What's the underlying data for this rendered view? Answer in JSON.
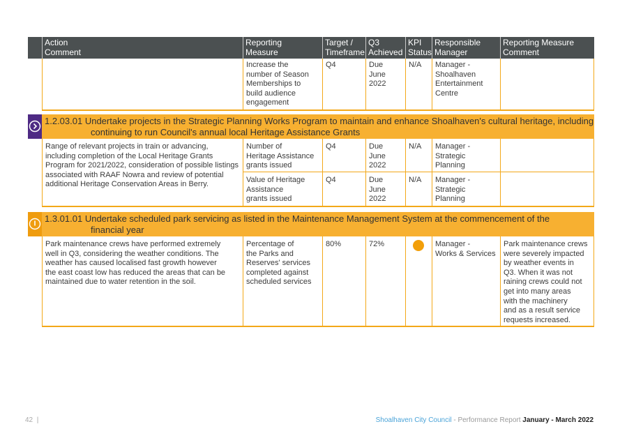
{
  "header": {
    "columns": [
      {
        "label1": "Action",
        "label2": "Comment"
      },
      {
        "label1": "Reporting",
        "label2": "Measure"
      },
      {
        "label1": "Target /",
        "label2": "Timeframe"
      },
      {
        "label1": "Q3",
        "label2": "Achieved"
      },
      {
        "label1": "KPI",
        "label2": "Status"
      },
      {
        "label1": "Responsible",
        "label2": "Manager"
      },
      {
        "label1": "Reporting Measure",
        "label2": "Comment"
      }
    ]
  },
  "continued_row": {
    "action_comment": "",
    "measure_lines": [
      "Increase the",
      "number of Season",
      "Memberships to",
      "build audience",
      "engagement"
    ],
    "target": "Q4",
    "achieved_lines": [
      "Due",
      "June",
      "2022"
    ],
    "kpi_status": "N/A",
    "manager_lines": [
      "Manager -",
      "Shoalhaven",
      "Entertainment",
      "Centre"
    ],
    "measure_comment": ""
  },
  "actions": [
    {
      "code": "1.2.03.01",
      "icon": "chevron-right-circle-icon",
      "badge_color": "#4e2a84",
      "title_line1": "1.2.03.01 Undertake projects in the Strategic Planning Works Program to maintain and enhance Shoalhaven's cultural heritage, including",
      "title_line2": "continuing to run Council's annual local Heritage Assistance Grants",
      "comment_lines": [
        "Range of relevant projects in train or advancing,",
        "including completion of the Local Heritage Grants",
        "Program for 2021/2022, consideration of possible listings",
        "associated with RAAF Nowra and review of potential",
        "additional Heritage Conservation Areas in Berry."
      ],
      "rows": [
        {
          "measure_lines": [
            "Number of",
            "Heritage Assistance",
            "grants issued"
          ],
          "target": "Q4",
          "achieved_lines": [
            "Due",
            "June",
            "2022"
          ],
          "kpi_status": "N/A",
          "manager_lines": [
            "Manager -",
            "Strategic",
            "Planning"
          ],
          "measure_comment": ""
        },
        {
          "measure_lines": [
            "Value of Heritage",
            "Assistance",
            "grants issued"
          ],
          "target": "Q4",
          "achieved_lines": [
            "Due",
            "June",
            "2022"
          ],
          "kpi_status": "N/A",
          "manager_lines": [
            "Manager -",
            "Strategic",
            "Planning"
          ],
          "measure_comment": ""
        }
      ]
    },
    {
      "code": "1.3.01.01",
      "icon": "alert-circle-icon",
      "badge_color": "#ef9c0f",
      "title_line1": "1.3.01.01 Undertake scheduled park servicing as listed in the Maintenance Management System at the commencement of the",
      "title_line2": "financial year",
      "comment_lines": [
        "Park maintenance crews have performed extremely",
        "well in Q3, considering the weather conditions. The",
        "weather has caused localised fast growth however",
        "the east coast low has reduced the areas that can be",
        "maintained due to water retention in the soil."
      ],
      "rows": [
        {
          "measure_lines": [
            "Percentage of",
            "the Parks and",
            "Reserves' services",
            "completed against",
            "scheduled services"
          ],
          "target": "80%",
          "achieved_lines": [
            "72%"
          ],
          "kpi_status": "status-dot-orange",
          "kpi_color": "#f29f0a",
          "manager_lines": [
            "Manager -",
            "Works & Services"
          ],
          "measure_comment_lines": [
            "Park maintenance crews",
            "were severely impacted",
            "by weather events in",
            "Q3. When it was not",
            "raining crews could not",
            "get into many areas",
            "with the machinery",
            "and as a result service",
            "requests increased."
          ]
        }
      ]
    }
  ],
  "footer": {
    "page_number": "42",
    "separator": "|",
    "org": "Shoalhaven City Council",
    "dash": " - Performance Report ",
    "period": "January - March 2022"
  }
}
